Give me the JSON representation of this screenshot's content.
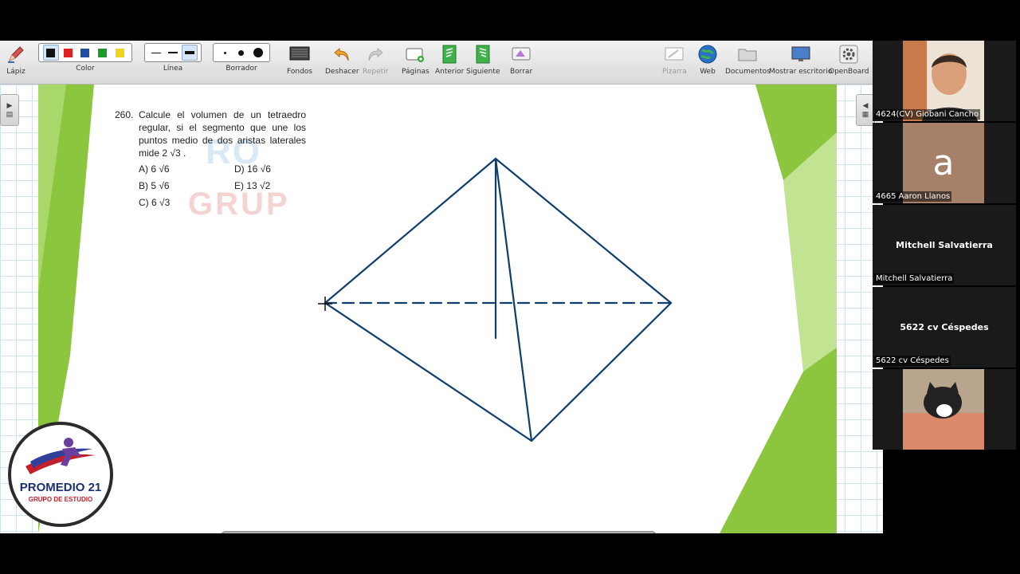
{
  "toolbar": {
    "pen_label": "Lápiz",
    "color_label": "Color",
    "line_label": "Línea",
    "eraser_label": "Borrador",
    "backgrounds_label": "Fondos",
    "undo_label": "Deshacer",
    "redo_label": "Repetir",
    "pages_label": "Páginas",
    "previous_label": "Anterior",
    "next_label": "Siguiente",
    "erase_label": "Borrar",
    "board_label": "Pizarra",
    "web_label": "Web",
    "documents_label": "Documentos",
    "desktop_label": "Mostrar escritorio",
    "openboard_label": "OpenBoard",
    "colors": [
      "#111111",
      "#e02020",
      "#1f4fa0",
      "#1a9a2a",
      "#f2d21b"
    ]
  },
  "problem": {
    "number": "260.",
    "statement": "Calcule el volumen de un tetraedro regular, si el segmento que une los puntos medio de dos aristas laterales mide 2 √3 .",
    "options": [
      "A) 6 √6",
      "D) 16 √6",
      "B) 5 √6",
      "E) 13 √2",
      "C) 6 √3",
      ""
    ],
    "watermark_1": "RO",
    "watermark_2": "GRUP"
  },
  "logo": {
    "title": "PROMEDIO 21",
    "subtitle": "GRUPO DE ESTUDIO"
  },
  "drawing": {
    "stroke_color": "#0e3e6e"
  },
  "participants": [
    {
      "name": "4624(CV) Giobani Cancho",
      "center": "",
      "avatar": ""
    },
    {
      "name": "4665 Aaron Llanos",
      "center": "",
      "avatar": "a"
    },
    {
      "name": "Mitchell Salvatierra",
      "center": "Mitchell Salvatierra",
      "avatar": ""
    },
    {
      "name": "5622 cv Céspedes",
      "center": "5622 cv Céspedes",
      "avatar": ""
    },
    {
      "name": "",
      "center": "",
      "avatar": ""
    }
  ]
}
